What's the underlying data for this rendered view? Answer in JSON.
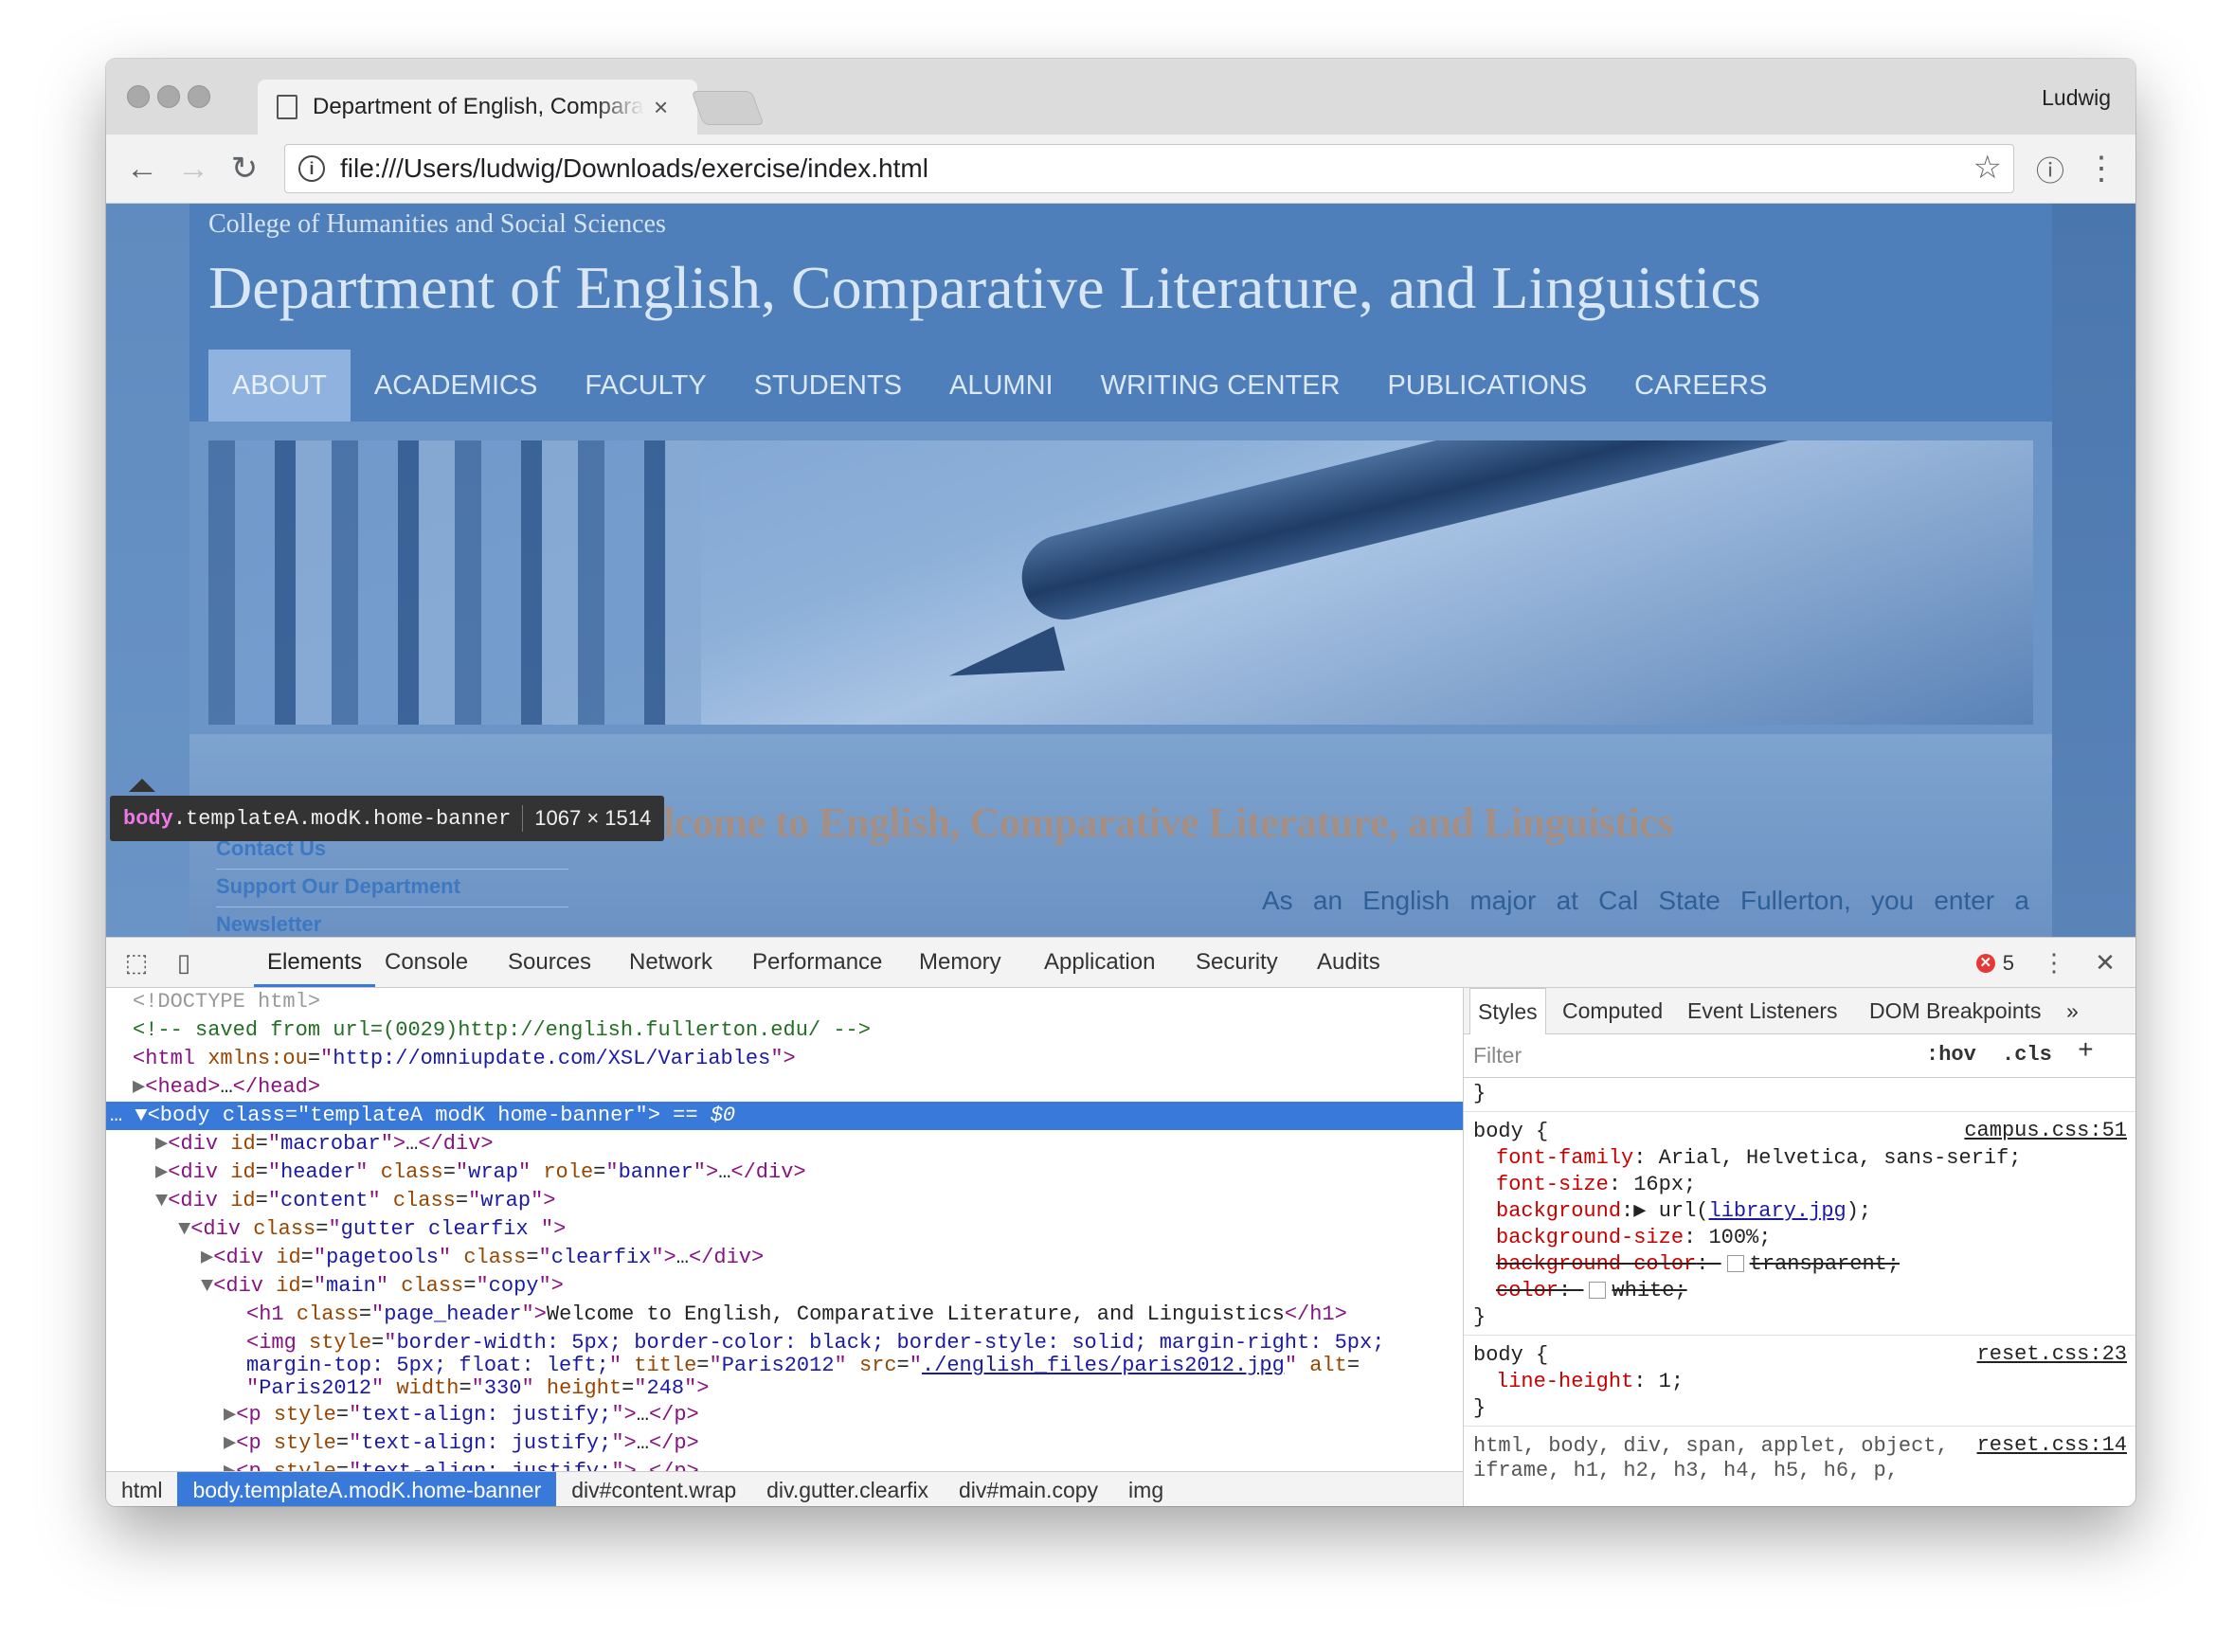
{
  "browser": {
    "tab_title": "Department of English, Comparative Literature, and Linguistics",
    "tab_close": "×",
    "profile": "Ludwig",
    "url": "file:///Users/ludwig/Downloads/exercise/index.html",
    "icons": {
      "back": "←",
      "forward": "→",
      "reload": "↻",
      "info": "i",
      "star": "☆",
      "extension": "ⓘ",
      "menu": "⋮"
    }
  },
  "page": {
    "college": "College of Humanities and Social Sciences",
    "department": "Department of English, Comparative Literature, and Linguistics",
    "nav": [
      "ABOUT",
      "ACADEMICS",
      "FACULTY",
      "STUDENTS",
      "ALUMNI",
      "WRITING CENTER",
      "PUBLICATIONS",
      "CAREERS"
    ],
    "side_links": [
      "Contact Us",
      "Support Our Department",
      "Newsletter"
    ],
    "welcome": "Welcome to English, Comparative Literature, and Linguistics",
    "intro_words": [
      "As",
      "an",
      "English",
      "major",
      "at",
      "Cal",
      "State",
      "Fullerton,",
      "you",
      "enter",
      "a"
    ]
  },
  "inspect_tooltip": {
    "tag": "body",
    "classes": ".templateA.modK.home-banner",
    "size": "1067 × 1514"
  },
  "devtools": {
    "tabs": [
      "Elements",
      "Console",
      "Sources",
      "Network",
      "Performance",
      "Memory",
      "Application",
      "Security",
      "Audits"
    ],
    "active_tab": "Elements",
    "error_count": "5",
    "dom": {
      "doctype": "<!DOCTYPE html>",
      "comment": "<!-- saved from url=(0029)http://english.fullerton.edu/ -->",
      "html_ns": "http://omniupdate.com/XSL/Variables",
      "body_class": "templateA modK home-banner",
      "body_eq": "== $0",
      "macrobar_id": "macrobar",
      "header_id": "header",
      "header_class": "wrap",
      "header_role": "banner",
      "content_id": "content",
      "content_class": "wrap",
      "gutter_class": "gutter clearfix ",
      "pagetools_id": "pagetools",
      "pagetools_class": "clearfix",
      "main_id": "main",
      "main_class": "copy",
      "h1_class": "page_header",
      "h1_text": "Welcome to English, Comparative Literature, and Linguistics",
      "img_style_1": "border-width: 5px; border-color: black; border-style: solid; margin-right: 5px;",
      "img_style_2": "margin-top: 5px; float: left;",
      "img_title": "Paris2012",
      "img_src": "./english_files/paris2012.jpg",
      "img_alt": "Paris2012",
      "img_width": "330",
      "img_height": "248",
      "p_style": "text-align: justify;"
    },
    "breadcrumbs": [
      "html",
      "body.templateA.modK.home-banner",
      "div#content.wrap",
      "div.gutter.clearfix",
      "div#main.copy",
      "img"
    ],
    "sidebar_tabs": [
      "Styles",
      "Computed",
      "Event Listeners",
      "DOM Breakpoints",
      "»"
    ],
    "filter_placeholder": "Filter",
    "filter_hov": ":hov",
    "filter_cls": ".cls",
    "filter_add": "+",
    "styles": {
      "rule1_selector": "body {",
      "rule1_src": "campus.css:51",
      "rule1": [
        {
          "prop": "font-family",
          "val": "Arial, Helvetica, sans-serif;"
        },
        {
          "prop": "font-size",
          "val": "16px;"
        },
        {
          "prop": "background",
          "val": "url(",
          "link": "library.jpg",
          "tail": ");"
        },
        {
          "prop": "background-size",
          "val": "100%;"
        },
        {
          "prop": "background-color",
          "val": "transparent;"
        },
        {
          "prop": "color",
          "val": "white;"
        }
      ],
      "rule2_selector": "body {",
      "rule2_src": "reset.css:23",
      "rule2_prop": "line-height",
      "rule2_val": "1;",
      "rule3_selectors_1": "html, body, div, span, applet, object,",
      "rule3_selectors_2": "iframe, h1, h2, h3, h4, h5, h6, p,",
      "rule3_src": "reset.css:14"
    }
  }
}
